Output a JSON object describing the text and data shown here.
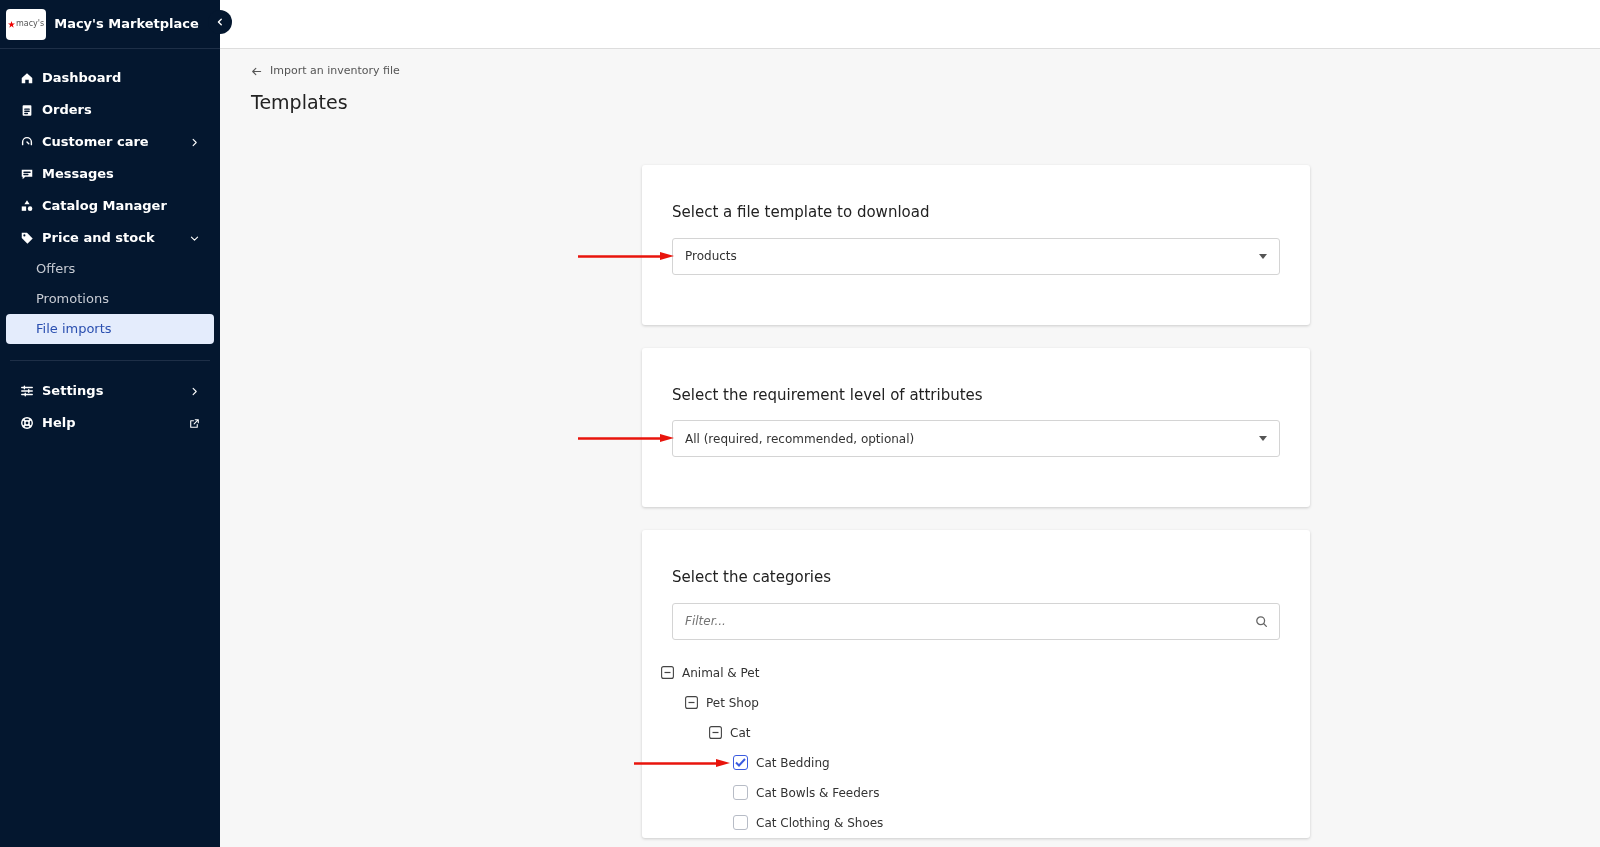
{
  "sidebar": {
    "logo_text": "macy's",
    "title": "Macy's Marketplace",
    "items": [
      {
        "kind": "item",
        "label": "Dashboard",
        "selected": false
      },
      {
        "kind": "item",
        "label": "Orders",
        "selected": false
      },
      {
        "kind": "group",
        "label": "Customer care",
        "selected": false,
        "expanded": false
      },
      {
        "kind": "item",
        "label": "Messages",
        "selected": false
      },
      {
        "kind": "item",
        "label": "Catalog Manager",
        "selected": false
      },
      {
        "kind": "group",
        "label": "Price and stock",
        "selected": false,
        "expanded": true
      },
      {
        "kind": "subitem",
        "label": "Offers",
        "selected": false
      },
      {
        "kind": "subitem",
        "label": "Promotions",
        "selected": false
      },
      {
        "kind": "subitem",
        "label": "File imports",
        "selected": true
      },
      {
        "kind": "divider"
      },
      {
        "kind": "group",
        "label": "Settings",
        "selected": false,
        "expanded": false
      },
      {
        "kind": "external",
        "label": "Help",
        "selected": false
      }
    ]
  },
  "breadcrumb": "Import an inventory file",
  "page_title": "Templates",
  "cards": [
    {
      "kind": "select",
      "title": "Select a file template to download",
      "value": "Products",
      "annotated": true
    },
    {
      "kind": "select",
      "title": "Select the requirement level of attributes",
      "value": "All (required, recommended, optional)",
      "annotated": true
    },
    {
      "kind": "tree",
      "title": "Select the categories",
      "placeholder": "Filter...",
      "tree": [
        {
          "label": "Animal & Pet",
          "expanded": true,
          "children": [
            {
              "label": "Pet Shop",
              "expanded": true,
              "children": [
                {
                  "label": "Cat",
                  "expanded": true,
                  "children": [
                    {
                      "label": "Cat Bedding",
                      "checked": true,
                      "annotated": true
                    },
                    {
                      "label": "Cat Bowls & Feeders",
                      "checked": false
                    },
                    {
                      "label": "Cat Clothing & Shoes",
                      "checked": false
                    }
                  ]
                }
              ]
            }
          ]
        }
      ]
    }
  ]
}
